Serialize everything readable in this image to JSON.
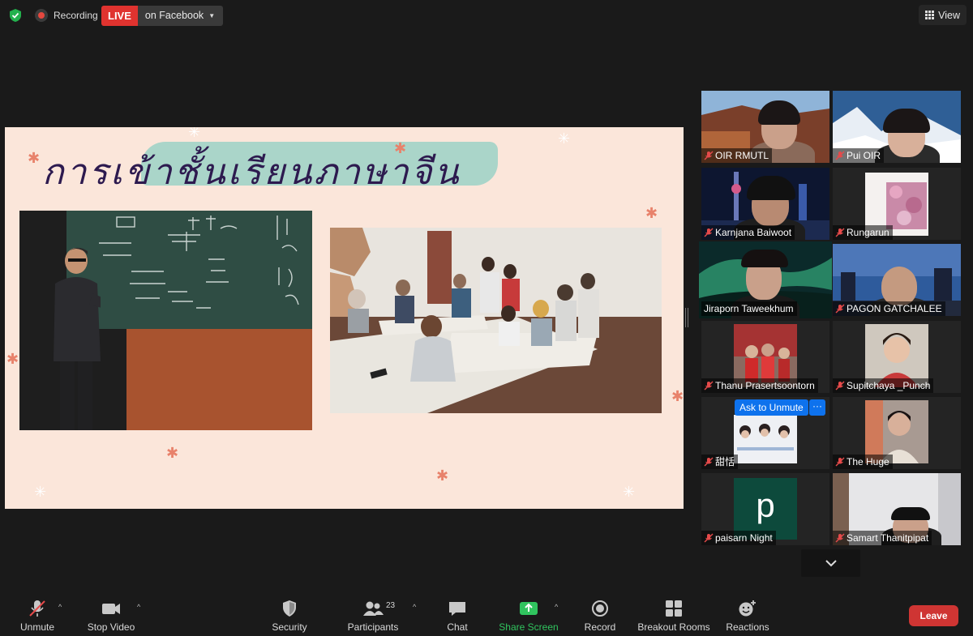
{
  "topbar": {
    "recording_label": "Recording",
    "live_badge": "LIVE",
    "live_target": "on Facebook",
    "view_label": "View"
  },
  "slide": {
    "title": "การเข้าชั้นเรียนภาษาจีน"
  },
  "participants": [
    {
      "name": "OIR RMUTL",
      "muted": true
    },
    {
      "name": "Pui OIR",
      "muted": true
    },
    {
      "name": "Karnjana Baiwoot",
      "muted": true
    },
    {
      "name": "Rungarun",
      "muted": true
    },
    {
      "name": "Jiraporn Taweekhum",
      "muted": false,
      "active_speaker": true
    },
    {
      "name": "PAGON GATCHALEE",
      "muted": true
    },
    {
      "name": "Thanu Prasertsoontorn",
      "muted": true
    },
    {
      "name": "Supitchaya _Punch",
      "muted": true
    },
    {
      "name": "甜恬",
      "muted": true
    },
    {
      "name": "The Huge",
      "muted": true
    },
    {
      "name": "paisarn Night",
      "muted": true,
      "avatar_letter": "p"
    },
    {
      "name": "Samart Thanitpipat",
      "muted": true
    }
  ],
  "hover_controls": {
    "ask_to_unmute": "Ask to Unmute",
    "more": "···"
  },
  "toolbar": {
    "unmute": "Unmute",
    "stop_video": "Stop Video",
    "security": "Security",
    "participants": "Participants",
    "participant_count": "23",
    "chat": "Chat",
    "share_screen": "Share Screen",
    "record": "Record",
    "breakout_rooms": "Breakout Rooms",
    "reactions": "Reactions",
    "leave": "Leave"
  },
  "colors": {
    "live_red": "#e0332f",
    "share_green": "#30c45e",
    "leave_red": "#cf3533",
    "active_speaker": "#c6dc63",
    "ask_unmute_blue": "#0e72ed"
  }
}
